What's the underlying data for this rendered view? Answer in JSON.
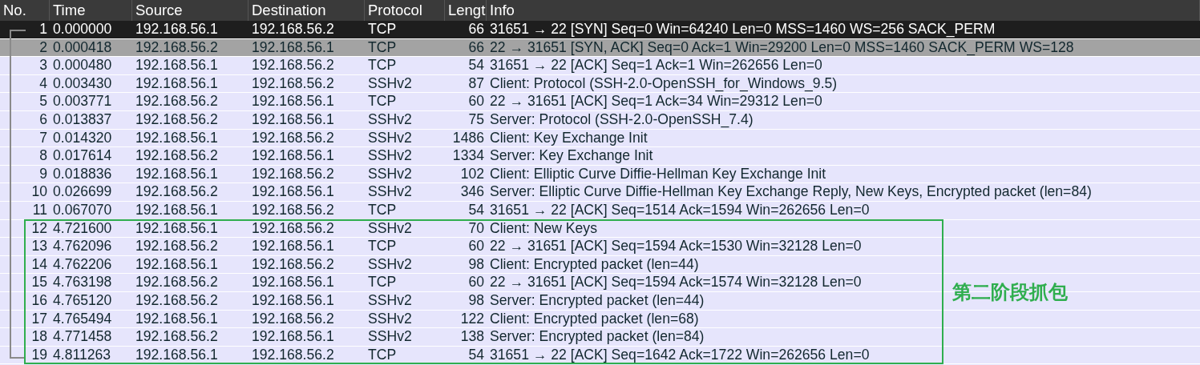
{
  "columns": [
    "No.",
    "Time",
    "Source",
    "Destination",
    "Protocol",
    "Lengt",
    "Info"
  ],
  "groups": [
    {
      "outlined": false,
      "rows": [
        {
          "no": "1",
          "time": "0.000000",
          "source": "192.168.56.1",
          "destination": "192.168.56.2",
          "protocol": "TCP",
          "length": "66",
          "info": "31651 → 22 [SYN] Seq=0 Win=64240 Len=0 MSS=1460 WS=256 SACK_PERM",
          "selected": true,
          "highlighted": false
        },
        {
          "no": "2",
          "time": "0.000418",
          "source": "192.168.56.2",
          "destination": "192.168.56.1",
          "protocol": "TCP",
          "length": "66",
          "info": "22 → 31651 [SYN, ACK] Seq=0 Ack=1 Win=29200 Len=0 MSS=1460 SACK_PERM WS=128",
          "selected": false,
          "highlighted": true
        },
        {
          "no": "3",
          "time": "0.000480",
          "source": "192.168.56.1",
          "destination": "192.168.56.2",
          "protocol": "TCP",
          "length": "54",
          "info": "31651 → 22 [ACK] Seq=1 Ack=1 Win=262656 Len=0",
          "selected": false,
          "highlighted": false
        },
        {
          "no": "4",
          "time": "0.003430",
          "source": "192.168.56.1",
          "destination": "192.168.56.2",
          "protocol": "SSHv2",
          "length": "87",
          "info": "Client: Protocol (SSH-2.0-OpenSSH_for_Windows_9.5)",
          "selected": false,
          "highlighted": false
        },
        {
          "no": "5",
          "time": "0.003771",
          "source": "192.168.56.2",
          "destination": "192.168.56.1",
          "protocol": "TCP",
          "length": "60",
          "info": "22 → 31651 [ACK] Seq=1 Ack=34 Win=29312 Len=0",
          "selected": false,
          "highlighted": false
        },
        {
          "no": "6",
          "time": "0.013837",
          "source": "192.168.56.2",
          "destination": "192.168.56.1",
          "protocol": "SSHv2",
          "length": "75",
          "info": "Server: Protocol (SSH-2.0-OpenSSH_7.4)",
          "selected": false,
          "highlighted": false
        },
        {
          "no": "7",
          "time": "0.014320",
          "source": "192.168.56.1",
          "destination": "192.168.56.2",
          "protocol": "SSHv2",
          "length": "1486",
          "info": "Client: Key Exchange Init",
          "selected": false,
          "highlighted": false
        },
        {
          "no": "8",
          "time": "0.017614",
          "source": "192.168.56.2",
          "destination": "192.168.56.1",
          "protocol": "SSHv2",
          "length": "1334",
          "info": "Server: Key Exchange Init",
          "selected": false,
          "highlighted": false
        },
        {
          "no": "9",
          "time": "0.018836",
          "source": "192.168.56.1",
          "destination": "192.168.56.2",
          "protocol": "SSHv2",
          "length": "102",
          "info": "Client: Elliptic Curve Diffie-Hellman Key Exchange Init",
          "selected": false,
          "highlighted": false
        },
        {
          "no": "10",
          "time": "0.026699",
          "source": "192.168.56.2",
          "destination": "192.168.56.1",
          "protocol": "SSHv2",
          "length": "346",
          "info": "Server: Elliptic Curve Diffie-Hellman Key Exchange Reply, New Keys, Encrypted packet (len=84)",
          "selected": false,
          "highlighted": false
        },
        {
          "no": "11",
          "time": "0.067070",
          "source": "192.168.56.1",
          "destination": "192.168.56.2",
          "protocol": "TCP",
          "length": "54",
          "info": "31651 → 22 [ACK] Seq=1514 Ack=1594 Win=262656 Len=0",
          "selected": false,
          "highlighted": false
        }
      ]
    },
    {
      "outlined": true,
      "label": "第二阶段抓包",
      "rows": [
        {
          "no": "12",
          "time": "4.721600",
          "source": "192.168.56.1",
          "destination": "192.168.56.2",
          "protocol": "SSHv2",
          "length": "70",
          "info": "Client: New Keys",
          "selected": false,
          "highlighted": false
        },
        {
          "no": "13",
          "time": "4.762096",
          "source": "192.168.56.2",
          "destination": "192.168.56.1",
          "protocol": "TCP",
          "length": "60",
          "info": "22 → 31651 [ACK] Seq=1594 Ack=1530 Win=32128 Len=0",
          "selected": false,
          "highlighted": false
        },
        {
          "no": "14",
          "time": "4.762206",
          "source": "192.168.56.1",
          "destination": "192.168.56.2",
          "protocol": "SSHv2",
          "length": "98",
          "info": "Client: Encrypted packet (len=44)",
          "selected": false,
          "highlighted": false
        },
        {
          "no": "15",
          "time": "4.763198",
          "source": "192.168.56.2",
          "destination": "192.168.56.1",
          "protocol": "TCP",
          "length": "60",
          "info": "22 → 31651 [ACK] Seq=1594 Ack=1574 Win=32128 Len=0",
          "selected": false,
          "highlighted": false
        },
        {
          "no": "16",
          "time": "4.765120",
          "source": "192.168.56.2",
          "destination": "192.168.56.1",
          "protocol": "SSHv2",
          "length": "98",
          "info": "Server: Encrypted packet (len=44)",
          "selected": false,
          "highlighted": false
        },
        {
          "no": "17",
          "time": "4.765494",
          "source": "192.168.56.1",
          "destination": "192.168.56.2",
          "protocol": "SSHv2",
          "length": "122",
          "info": "Client: Encrypted packet (len=68)",
          "selected": false,
          "highlighted": false
        },
        {
          "no": "18",
          "time": "4.771458",
          "source": "192.168.56.2",
          "destination": "192.168.56.1",
          "protocol": "SSHv2",
          "length": "138",
          "info": "Server: Encrypted packet (len=84)",
          "selected": false,
          "highlighted": false
        },
        {
          "no": "19",
          "time": "4.811263",
          "source": "192.168.56.1",
          "destination": "192.168.56.2",
          "protocol": "TCP",
          "length": "54",
          "info": "31651 → 22 [ACK] Seq=1642 Ack=1722 Win=262656 Len=0",
          "selected": false,
          "highlighted": false
        }
      ]
    }
  ]
}
